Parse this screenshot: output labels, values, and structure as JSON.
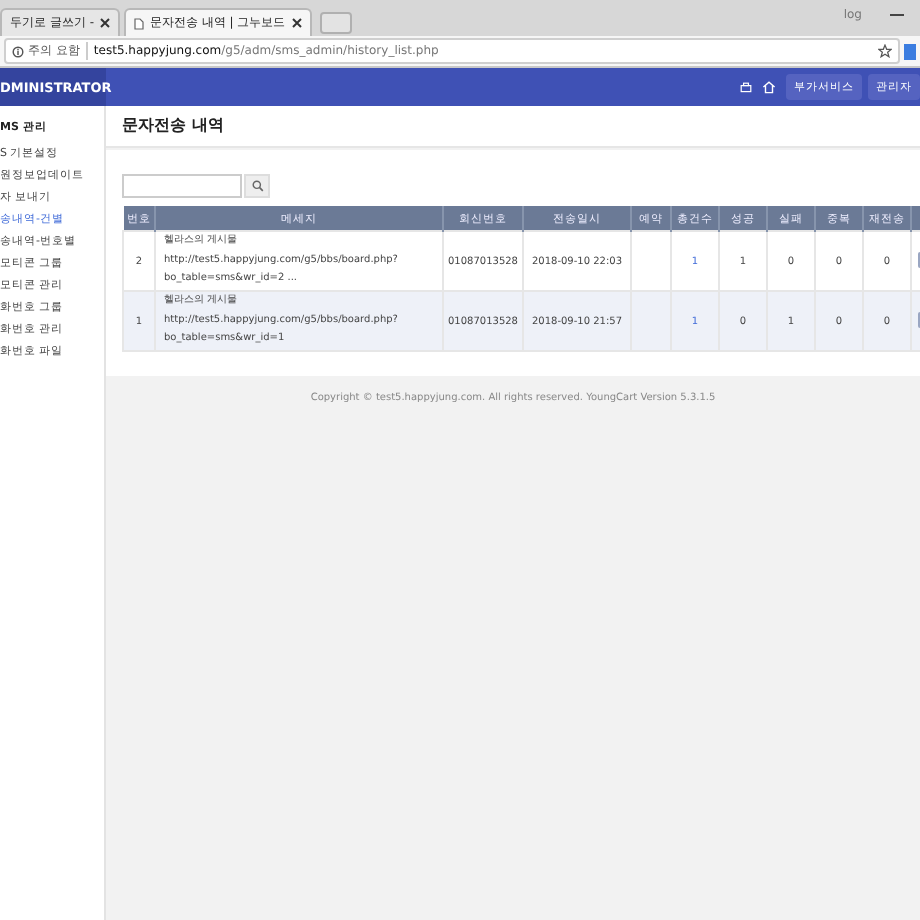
{
  "browser": {
    "tabs": [
      {
        "label": "두기로 글쓰기 -",
        "selected": false
      },
      {
        "label": "문자전송 내역 | 그누보드",
        "selected": true
      }
    ],
    "profile": "log",
    "security_label": "주의 요함",
    "url_host": "test5.happyjung.com",
    "url_path": "/g5/adm/sms_admin/history_list.php"
  },
  "header": {
    "logo": "DMINISTRATOR",
    "buttons": [
      "부가서비스",
      "관리자"
    ]
  },
  "sidebar": {
    "title": "MS 관리",
    "items": [
      {
        "label": "S 기본설정",
        "selected": false
      },
      {
        "label": "원정보업데이트",
        "selected": false
      },
      {
        "label": "자 보내기",
        "selected": false
      },
      {
        "label": "송내역-건별",
        "selected": true
      },
      {
        "label": "송내역-번호별",
        "selected": false
      },
      {
        "label": "모티콘 그룹",
        "selected": false
      },
      {
        "label": "모티콘 관리",
        "selected": false
      },
      {
        "label": "화번호 그룹",
        "selected": false
      },
      {
        "label": "화번호 관리",
        "selected": false
      },
      {
        "label": "화번호 파일",
        "selected": false
      }
    ]
  },
  "page_title": "문자전송 내역",
  "table": {
    "columns": [
      "번호",
      "메세지",
      "회신번호",
      "전송일시",
      "예약",
      "총건수",
      "성공",
      "실패",
      "중복",
      "재전송"
    ],
    "rows": [
      {
        "no": "2",
        "message": [
          "헬라스의 게시물",
          "http://test5.happyjung.com/g5/bbs/board.php?",
          "bo_table=sms&wr_id=2 ..."
        ],
        "reply_number": "01087013528",
        "sent_at": "2018-09-10 22:03",
        "total": "1",
        "success": "1",
        "fail": "0",
        "duplicate": "0",
        "resend": "0"
      },
      {
        "no": "1",
        "message": [
          "헬라스의 게시물",
          "http://test5.happyjung.com/g5/bbs/board.php?",
          "bo_table=sms&wr_id=1"
        ],
        "reply_number": "01087013528",
        "sent_at": "2018-09-10 21:57",
        "total": "1",
        "success": "0",
        "fail": "1",
        "duplicate": "0",
        "resend": "0"
      }
    ]
  },
  "footer": "Copyright © test5.happyjung.com. All rights reserved. YoungCart Version 5.3.1.5"
}
